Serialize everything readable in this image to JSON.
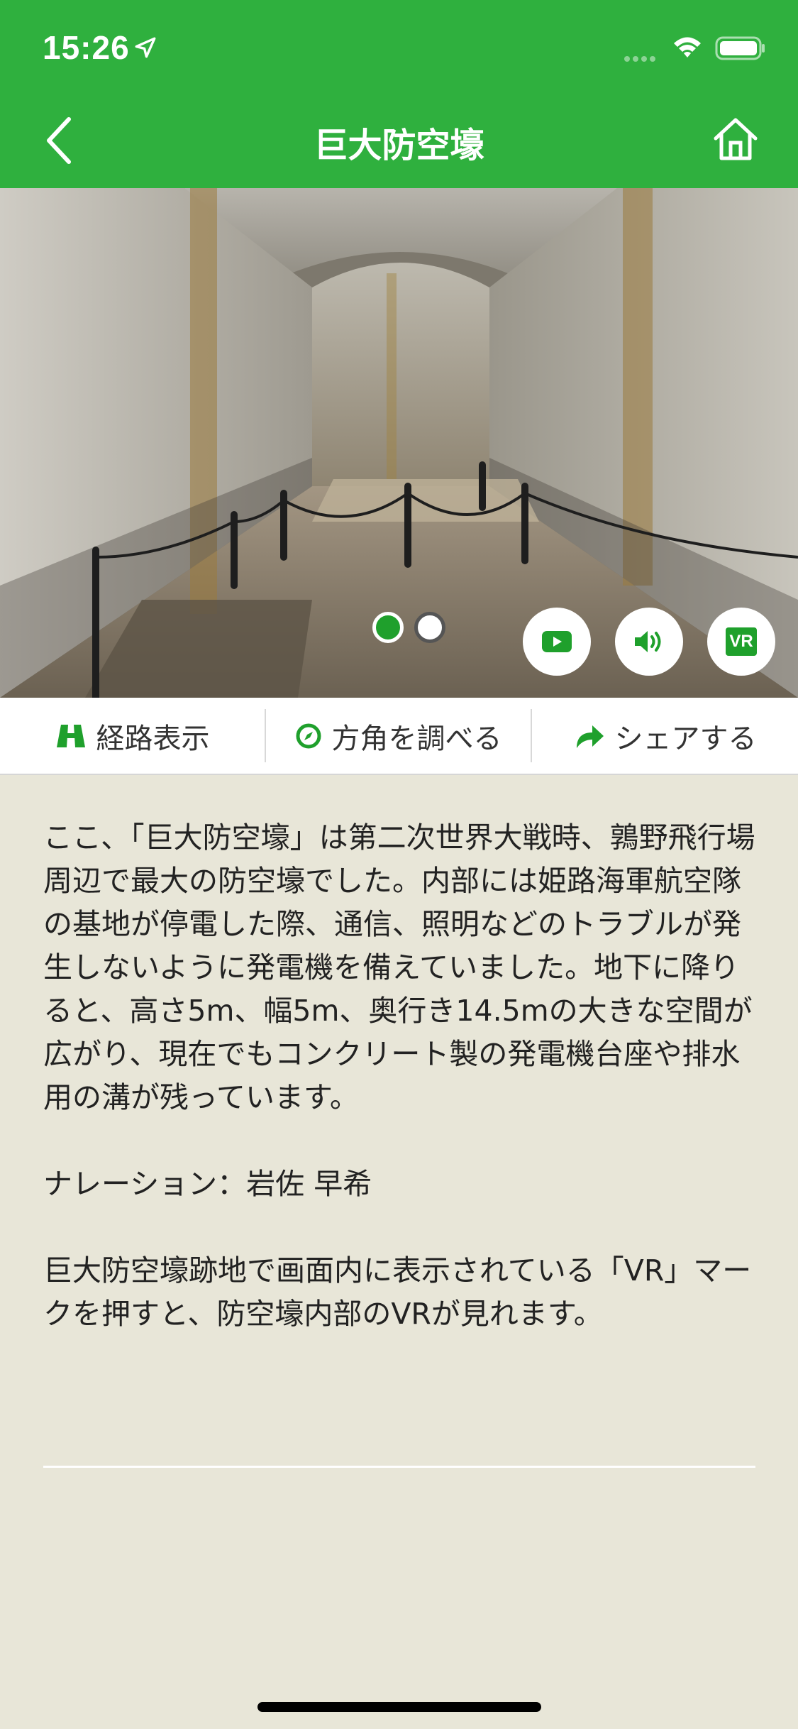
{
  "status": {
    "time": "15:26"
  },
  "header": {
    "title": "巨大防空壕"
  },
  "actions": {
    "route_label": "経路表示",
    "direction_label": "方角を調べる",
    "share_label": "シェアする"
  },
  "media": {
    "vr_label": "VR"
  },
  "content": {
    "description": "ここ、「巨大防空壕」は第二次世界大戦時、鶉野飛行場周辺で最大の防空壕でした。内部には姫路海軍航空隊の基地が停電した際、通信、照明などのトラブルが発生しないように発電機を備えていました。地下に降りると、高さ5m、幅5m、奥行き14.5mの大きな空間が広がり、現在でもコンクリート製の発電機台座や排水用の溝が残っています。",
    "narration": "ナレーション：岩佐 早希",
    "vr_note": "巨大防空壕跡地で画面内に表示されている「VR」マークを押すと、防空壕内部のVRが見れます。"
  },
  "colors": {
    "accent": "#2fb03e",
    "background": "#e8e6d8"
  }
}
